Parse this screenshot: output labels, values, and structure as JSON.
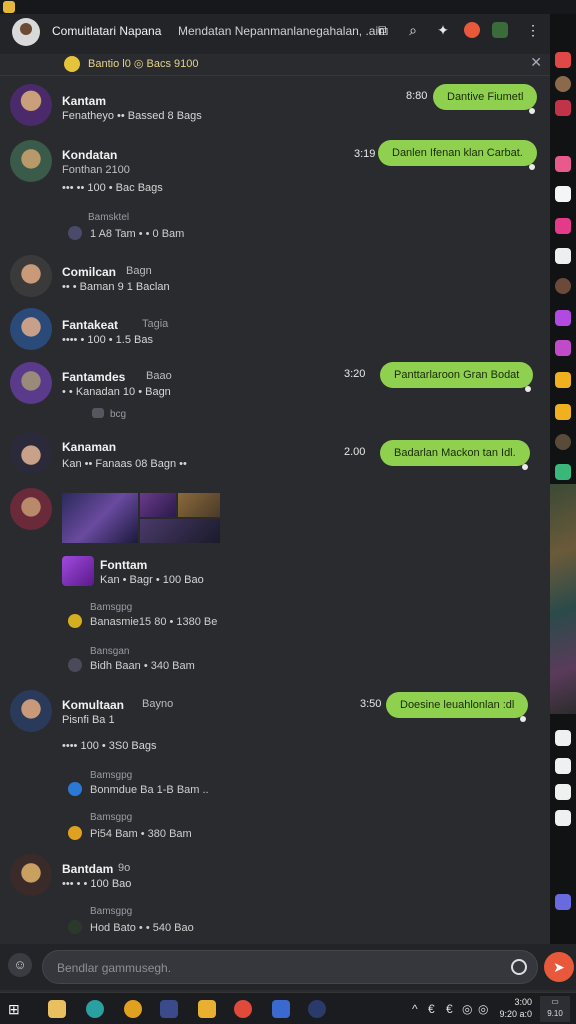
{
  "header": {
    "title": "Comuitlatari Napana",
    "subtitle": "Mendatan Nepanmanlanegahalan, .ain",
    "progress_fraction": 0.62
  },
  "pinned": {
    "text": "Bantio l0  ◎  Bacs 9100"
  },
  "messages": [
    {
      "name": "Kantam",
      "line": "Fenatheyo •• Bassed 8 Bags",
      "time": "8:80",
      "bubble": "Dantive Fiumetl"
    },
    {
      "name": "Kondatan",
      "line": "Fonthan 2100",
      "line2": "••• •• 100  • Bac Bags",
      "reply_label": "Bamsktel",
      "reply_text": "1 A8 Tam  • • 0 Bam",
      "time": "3:19",
      "bubble": "Danlen Ifenan klan Carbat."
    },
    {
      "name": "Comilcan",
      "name_suffix": "Bagn",
      "line": "•• • Baman 9 1 Baclan"
    },
    {
      "name": "Fantakeat",
      "name_suffix": "Tagia",
      "line": "•••• • 100  • 1.5 Bas"
    },
    {
      "name": "Fantamdes",
      "name_suffix": "Baao",
      "line": "• • Kanadan 10 • Bagn",
      "line2": "bcg",
      "time": "3:20",
      "bubble": "Panttarlaroon Gran Bodat"
    },
    {
      "name": "Kanaman",
      "line": "Kan •• Fanaas 08 Bagn ••",
      "time": "2.00",
      "bubble": "Badarlan Mackon tan Idl."
    },
    {
      "name": "Fonttam",
      "line": "Kan • Bagr  • 100 Bao",
      "reply_label": "Bamsgpg",
      "reply_text": "Banasmie15 80  • 1380 Be",
      "reply_label2": "Bansgan",
      "reply_text2": "Bidh Baan • 340 Bam"
    },
    {
      "name": "Komultaan",
      "name_suffix": "Bayno",
      "line": "Pisnfi Ba 1",
      "line2": "•••• 100  • 3S0 Bags",
      "reply_label": "Bamsgpg",
      "reply_text": "Bonmdue  Ba  1-B Bam ..",
      "reply_label2": "Bamsgpg",
      "reply_text2": "Pi54 Bam  • 380 Bam",
      "time": "3:50",
      "bubble": "Doesine leuahlonlan :dl"
    },
    {
      "name": "Bantdam",
      "name_suffix": "9o",
      "line": "••• • • 100 Bao",
      "reply_label": "Bamsgpg",
      "reply_text": "Hod  Bato  • • 540 Bao"
    }
  ],
  "composer": {
    "placeholder": "Bendlar gammusegh."
  },
  "taskbar": {
    "time": "3:00",
    "date": "9:20 a:0",
    "notif": "9.10"
  },
  "colors": {
    "bubble": "#8fd14f",
    "accent": "#e8583a",
    "background": "#2a2b2f"
  }
}
